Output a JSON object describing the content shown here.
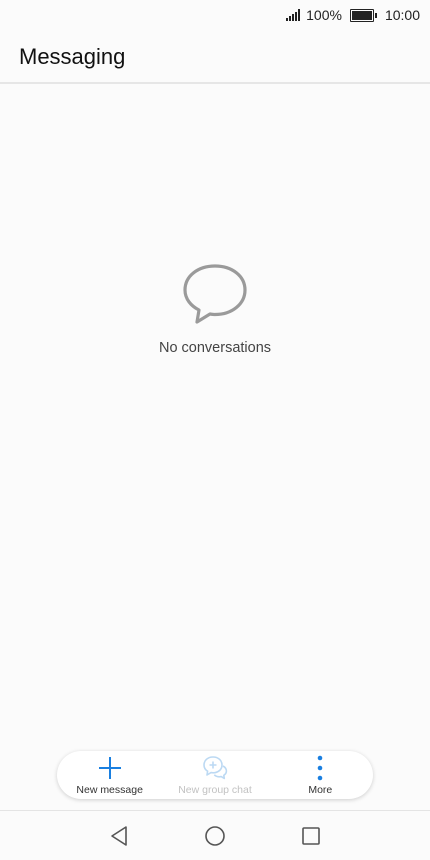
{
  "status_bar": {
    "battery": "100%",
    "time": "10:00",
    "icons": [
      "signal-icon",
      "battery-icon"
    ]
  },
  "header": {
    "title": "Messaging"
  },
  "empty_state": {
    "icon": "chat-bubble-icon",
    "text": "No conversations"
  },
  "action_bar": {
    "new_message": {
      "label": "New message",
      "icon": "plus-icon",
      "color": "#1a7fe0"
    },
    "new_group_chat": {
      "label": "New group chat",
      "icon": "group-chat-add-icon",
      "color": "#bcd9f3",
      "disabled": true
    },
    "more": {
      "label": "More",
      "icon": "more-vertical-icon",
      "color": "#1a7fe0"
    }
  },
  "nav_bar": {
    "icons": [
      "back-icon",
      "home-icon",
      "recents-icon"
    ]
  }
}
